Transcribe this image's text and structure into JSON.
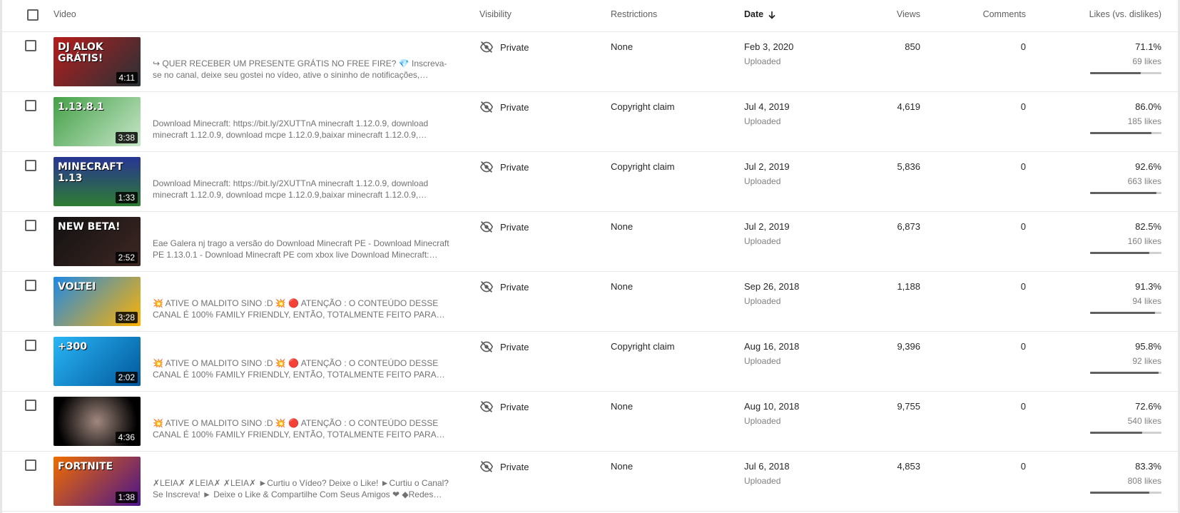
{
  "header": {
    "video": "Video",
    "visibility": "Visibility",
    "restrictions": "Restrictions",
    "date": "Date",
    "views": "Views",
    "comments": "Comments",
    "likes": "Likes (vs. dislikes)"
  },
  "colors": {
    "accent_bar": "#606060",
    "bar_track": "#d0d0d0"
  },
  "rows": [
    {
      "thumb_label": "DJ ALOK GRÁTIS!",
      "thumb_bg": "linear-gradient(135deg,#b71c1c,#263238)",
      "duration": "4:11",
      "description": "↪ QUER RECEBER UM PRESENTE GRÁTIS NO FREE FIRE? 💎 Inscreva-se no canal, deixe seu gostei no vídeo, ative o sininho de notificações, divulgue…",
      "visibility": "Private",
      "restrictions": "None",
      "date": "Feb 3, 2020",
      "date_sub": "Uploaded",
      "views": "850",
      "comments": "0",
      "likes_pct": "71.1%",
      "likes_count": "69 likes",
      "likes_ratio": 0.711
    },
    {
      "thumb_label": "1.13.8.1",
      "thumb_bg": "linear-gradient(135deg,#43a047,#c8e6c9)",
      "duration": "3:38",
      "description": "Download Minecraft: https://bit.ly/2XUTTnA minecraft 1.12.0.9, download minecraft 1.12.0.9, download mcpe 1.12.0.9,baixar minecraft 1.12.0.9,…",
      "visibility": "Private",
      "restrictions": "Copyright claim",
      "date": "Jul 4, 2019",
      "date_sub": "Uploaded",
      "views": "4,619",
      "comments": "0",
      "likes_pct": "86.0%",
      "likes_count": "185 likes",
      "likes_ratio": 0.86
    },
    {
      "thumb_label": "MINECRAFT 1.13",
      "thumb_bg": "linear-gradient(180deg,#283593,#2e7d32)",
      "duration": "1:33",
      "description": "Download Minecraft: https://bit.ly/2XUTTnA minecraft 1.12.0.9, download minecraft 1.12.0.9, download mcpe 1.12.0.9,baixar minecraft 1.12.0.9,…",
      "visibility": "Private",
      "restrictions": "Copyright claim",
      "date": "Jul 2, 2019",
      "date_sub": "Uploaded",
      "views": "5,836",
      "comments": "0",
      "likes_pct": "92.6%",
      "likes_count": "663 likes",
      "likes_ratio": 0.926
    },
    {
      "thumb_label": "NEW BETA!",
      "thumb_bg": "linear-gradient(135deg,#111,#3e2723)",
      "duration": "2:52",
      "description": "Eae Galera nj trago a versão do Download Minecraft PE - Download Minecraft PE 1.13.0.1 - Download Minecraft PE com xbox live Download Minecraft:…",
      "visibility": "Private",
      "restrictions": "None",
      "date": "Jul 2, 2019",
      "date_sub": "Uploaded",
      "views": "6,873",
      "comments": "0",
      "likes_pct": "82.5%",
      "likes_count": "160 likes",
      "likes_ratio": 0.825
    },
    {
      "thumb_label": "VOLTEI",
      "thumb_bg": "linear-gradient(135deg,#1e88e5,#ffb300)",
      "duration": "3:28",
      "description": "💥 ATIVE O MALDITO SINO :D 💥 🔴 ATENÇÃO : O CONTEÚDO DESSE CANAL É 100% FAMILY FRIENDLY, ENTÃO, TOTALMENTE FEITO PARA…",
      "visibility": "Private",
      "restrictions": "None",
      "date": "Sep 26, 2018",
      "date_sub": "Uploaded",
      "views": "1,188",
      "comments": "0",
      "likes_pct": "91.3%",
      "likes_count": "94 likes",
      "likes_ratio": 0.913
    },
    {
      "thumb_label": "+300",
      "thumb_bg": "linear-gradient(135deg,#29b6f6,#01579b)",
      "duration": "2:02",
      "description": "💥 ATIVE O MALDITO SINO :D 💥 🔴 ATENÇÃO : O CONTEÚDO DESSE CANAL É 100% FAMILY FRIENDLY, ENTÃO, TOTALMENTE FEITO PARA…",
      "visibility": "Private",
      "restrictions": "Copyright claim",
      "date": "Aug 16, 2018",
      "date_sub": "Uploaded",
      "views": "9,396",
      "comments": "0",
      "likes_pct": "95.8%",
      "likes_count": "92 likes",
      "likes_ratio": 0.958
    },
    {
      "thumb_label": "",
      "thumb_bg": "radial-gradient(circle,#a1887f,#000 80%)",
      "duration": "4:36",
      "description": "💥 ATIVE O MALDITO SINO :D 💥 🔴 ATENÇÃO : O CONTEÚDO DESSE CANAL É 100% FAMILY FRIENDLY, ENTÃO, TOTALMENTE FEITO PARA…",
      "visibility": "Private",
      "restrictions": "None",
      "date": "Aug 10, 2018",
      "date_sub": "Uploaded",
      "views": "9,755",
      "comments": "0",
      "likes_pct": "72.6%",
      "likes_count": "540 likes",
      "likes_ratio": 0.726
    },
    {
      "thumb_label": "FORTNITE",
      "thumb_bg": "linear-gradient(135deg,#ef6c00,#4a148c)",
      "duration": "1:38",
      "description": "✗LEIA✗ ✗LEIA✗ ✗LEIA✗ ►Curtiu o Vídeo? Deixe o Like! ►Curtiu o Canal? Se Inscreva! ► Deixe o Like & Compartilhe Com Seus Amigos ❤ ◆Redes…",
      "visibility": "Private",
      "restrictions": "None",
      "date": "Jul 6, 2018",
      "date_sub": "Uploaded",
      "views": "4,853",
      "comments": "0",
      "likes_pct": "83.3%",
      "likes_count": "808 likes",
      "likes_ratio": 0.833
    }
  ]
}
